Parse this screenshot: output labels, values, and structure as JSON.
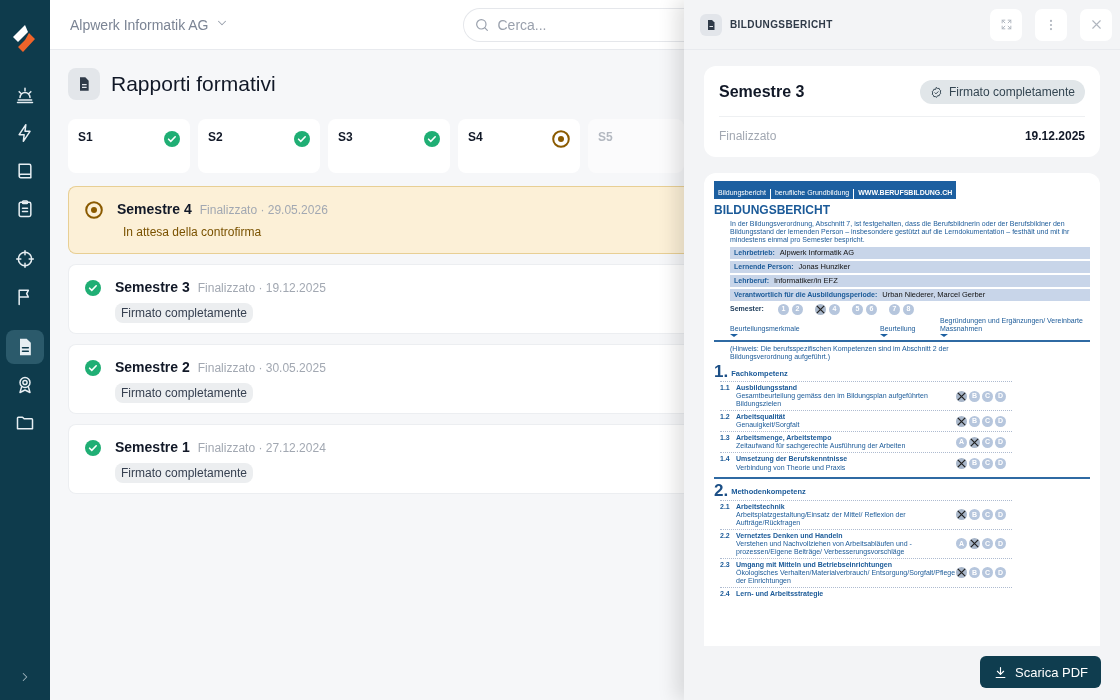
{
  "sidebar": {
    "items": [
      {
        "selected": false
      },
      {
        "selected": false
      },
      {
        "selected": false
      },
      {
        "selected": false
      },
      {
        "selected": false
      },
      {
        "selected": false
      },
      {
        "selected": true
      },
      {
        "selected": false
      },
      {
        "selected": false
      }
    ]
  },
  "header": {
    "company": "Alpwerk Informatik AG",
    "search": {
      "placeholder": "Cerca..."
    }
  },
  "page": {
    "title": "Rapporti formativi"
  },
  "tabs": [
    {
      "label": "S1",
      "kind": "signed",
      "disabled": false
    },
    {
      "label": "S2",
      "kind": "signed",
      "disabled": false
    },
    {
      "label": "S3",
      "kind": "signed",
      "disabled": false
    },
    {
      "label": "S4",
      "kind": "pending",
      "disabled": false
    },
    {
      "label": "S5",
      "disabled": true
    }
  ],
  "rows": [
    {
      "title": "Semestre 4",
      "meta": "Finalizzato · 29.05.2026",
      "kind": "pending",
      "note": "In attesa della controfirma"
    },
    {
      "title": "Semestre 3",
      "meta": "Finalizzato · 19.12.2025",
      "kind": "signed",
      "badge": "Firmato completamente"
    },
    {
      "title": "Semestre 2",
      "meta": "Finalizzato · 30.05.2025",
      "kind": "signed",
      "badge": "Firmato completamente"
    },
    {
      "title": "Semestre 1",
      "meta": "Finalizzato · 27.12.2024",
      "kind": "signed",
      "badge": "Firmato completamente"
    }
  ],
  "panel": {
    "title": "BILDUNGSBERICHT",
    "summary": {
      "title": "Semestre 3",
      "badge": "Firmato completamente",
      "label": "Finalizzato",
      "value": "19.12.2025"
    },
    "document": {
      "header_tabs": [
        "Bildungsbericht",
        "berufliche Grundbildung",
        "WWW.BERUFSBILDUNG.CH"
      ],
      "title": "BILDUNGSBERICHT",
      "intro": "In der Bildungsverordnung, Abschnitt 7, ist festgehalten, dass die Berufsbildnerin oder der Berufsbildner den Bildungsstand der lernenden Person – insbesondere gestützt auf die Lerndokumentation – festhält und mit ihr mindestens einmal pro Semester bespricht.",
      "fields": [
        {
          "label": "Lehrbetrieb:",
          "value": "Alpwerk Informatik AG"
        },
        {
          "label": "Lernende Person:",
          "value": "Jonas Hunziker"
        },
        {
          "label": "Lehrberuf:",
          "value": "Informatiker/in EFZ"
        },
        {
          "label": "Verantwortlich für die Ausbildungsperiode:",
          "value": "Urban Niederer, Marcel Gerber"
        }
      ],
      "semester_label": "Semester:",
      "semesters": [
        {
          "label": "1",
          "selected": false
        },
        {
          "label": "2",
          "selected": false
        },
        {
          "selected": true
        },
        {
          "label": "4",
          "selected": false
        },
        {
          "label": "5",
          "selected": false
        },
        {
          "label": "6",
          "selected": false
        },
        {
          "label": "7",
          "selected": false
        },
        {
          "label": "8",
          "selected": false
        }
      ],
      "columns": [
        "Beurteilungsmerkmale",
        "Beurteilung",
        "Begründungen und Ergänzungen/ Vereinbarte Massnahmen"
      ],
      "note": "(Hinweis: Die berufsspezifischen Kompetenzen sind im Abschnitt 2 der Bildungsverordnung aufgeführt.)",
      "sections": [
        {
          "number": "1.",
          "title": "Fachkompetenz",
          "items": [
            {
              "number": "1.1",
              "title": "Ausbildungsstand",
              "description": "Gesamtbeurteilung gemäss den im Bildungsplan aufgeführten Bildungszielen",
              "grades": [
                {
                  "selected": true
                },
                {
                  "label": "B",
                  "selected": false
                },
                {
                  "label": "C",
                  "selected": false
                },
                {
                  "label": "D",
                  "selected": false
                }
              ]
            },
            {
              "number": "1.2",
              "title": "Arbeitsqualität",
              "description": "Genauigkeit/Sorgfalt",
              "grades": [
                {
                  "selected": true
                },
                {
                  "label": "B",
                  "selected": false
                },
                {
                  "label": "C",
                  "selected": false
                },
                {
                  "label": "D",
                  "selected": false
                }
              ]
            },
            {
              "number": "1.3",
              "title": "Arbeitsmenge, Arbeitstempo",
              "description": "Zeitaufwand für sachgerechte Ausführung der Arbeiten",
              "grades": [
                {
                  "label": "A",
                  "selected": false
                },
                {
                  "selected": true
                },
                {
                  "label": "C",
                  "selected": false
                },
                {
                  "label": "D",
                  "selected": false
                }
              ]
            },
            {
              "number": "1.4",
              "title": "Umsetzung der Berufskenntnisse",
              "description": "Verbindung von Theorie und Praxis",
              "grades": [
                {
                  "selected": true
                },
                {
                  "label": "B",
                  "selected": false
                },
                {
                  "label": "C",
                  "selected": false
                },
                {
                  "label": "D",
                  "selected": false
                }
              ]
            }
          ]
        },
        {
          "number": "2.",
          "title": "Methodenkompetenz",
          "items": [
            {
              "number": "2.1",
              "title": "Arbeitstechnik",
              "description": "Arbeitsplatzgestaltung/Einsatz der Mittel/ Reflexion der Aufträge/Rückfragen",
              "grades": [
                {
                  "selected": true
                },
                {
                  "label": "B",
                  "selected": false
                },
                {
                  "label": "C",
                  "selected": false
                },
                {
                  "label": "D",
                  "selected": false
                }
              ]
            },
            {
              "number": "2.2",
              "title": "Vernetztes Denken und Handeln",
              "description": "Verstehen und Nachvollziehen von Arbeitsabläufen und -prozessen/Eigene Beiträge/ Verbesserungsvorschläge",
              "grades": [
                {
                  "label": "A",
                  "selected": false
                },
                {
                  "selected": true
                },
                {
                  "label": "C",
                  "selected": false
                },
                {
                  "label": "D",
                  "selected": false
                }
              ]
            },
            {
              "number": "2.3",
              "title": "Umgang mit Mitteln und Betriebseinrichtungen",
              "description": "Ökologisches Verhalten/Materialverbrauch/ Entsorgung/Sorgfalt/Pflege der Einrichtungen",
              "grades": [
                {
                  "selected": true
                },
                {
                  "label": "B",
                  "selected": false
                },
                {
                  "label": "C",
                  "selected": false
                },
                {
                  "label": "D",
                  "selected": false
                }
              ]
            },
            {
              "number": "2.4",
              "title": "Lern- und Arbeitsstrategie"
            }
          ]
        }
      ]
    },
    "download_button": "Scarica PDF"
  }
}
